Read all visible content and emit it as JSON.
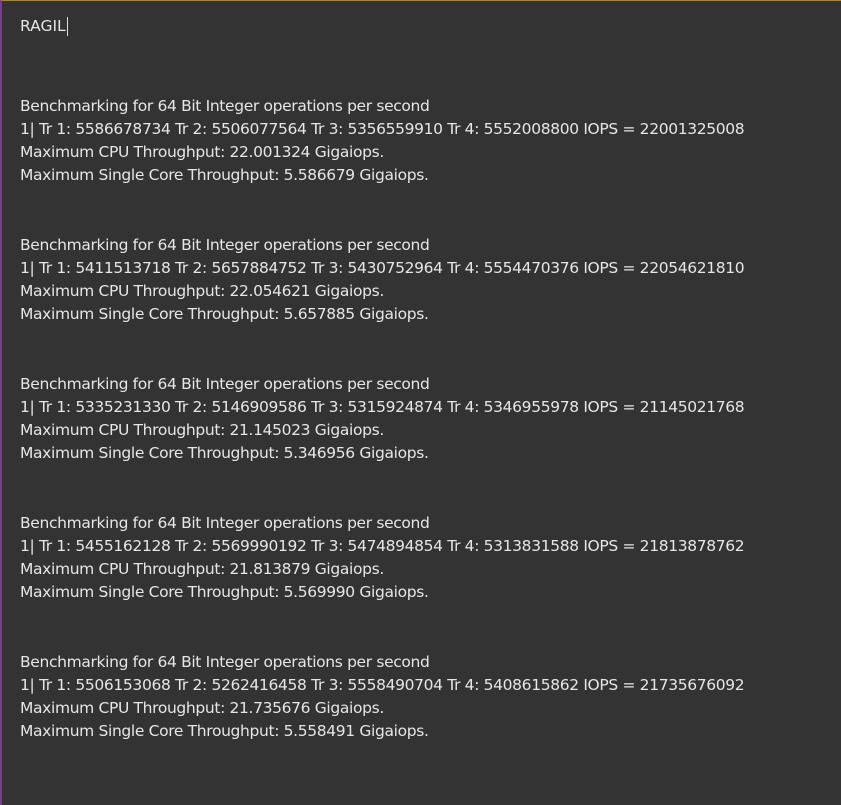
{
  "editor": {
    "input_text": "RAGIL",
    "blocks": [
      {
        "heading": "Benchmarking for 64 Bit Integer operations per second",
        "threads": "1| Tr 1: 5586678734 Tr 2: 5506077564 Tr 3: 5356559910 Tr 4: 5552008800 IOPS = 22001325008",
        "max_cpu": "Maximum CPU Throughput: 22.001324 Gigaiops.",
        "max_single": "Maximum Single Core Throughput: 5.586679 Gigaiops."
      },
      {
        "heading": "Benchmarking for 64 Bit Integer operations per second",
        "threads": "1| Tr 1: 5411513718 Tr 2: 5657884752 Tr 3: 5430752964 Tr 4: 5554470376 IOPS = 22054621810",
        "max_cpu": "Maximum CPU Throughput: 22.054621 Gigaiops.",
        "max_single": "Maximum Single Core Throughput: 5.657885 Gigaiops."
      },
      {
        "heading": "Benchmarking for 64 Bit Integer operations per second",
        "threads": "1| Tr 1: 5335231330 Tr 2: 5146909586 Tr 3: 5315924874 Tr 4: 5346955978 IOPS = 21145021768",
        "max_cpu": "Maximum CPU Throughput: 21.145023 Gigaiops.",
        "max_single": "Maximum Single Core Throughput: 5.346956 Gigaiops."
      },
      {
        "heading": "Benchmarking for 64 Bit Integer operations per second",
        "threads": "1| Tr 1: 5455162128 Tr 2: 5569990192 Tr 3: 5474894854 Tr 4: 5313831588 IOPS = 21813878762",
        "max_cpu": "Maximum CPU Throughput: 21.813879 Gigaiops.",
        "max_single": "Maximum Single Core Throughput: 5.569990 Gigaiops."
      },
      {
        "heading": "Benchmarking for 64 Bit Integer operations per second",
        "threads": "1| Tr 1: 5506153068 Tr 2: 5262416458 Tr 3: 5558490704 Tr 4: 5408615862 IOPS = 21735676092",
        "max_cpu": "Maximum CPU Throughput: 21.735676 Gigaiops.",
        "max_single": "Maximum Single Core Throughput: 5.558491 Gigaiops."
      }
    ]
  },
  "colors": {
    "background": "#333333",
    "text": "#e6e6e6",
    "top_border": "#b8860b",
    "left_border": "#7a3b8f"
  }
}
